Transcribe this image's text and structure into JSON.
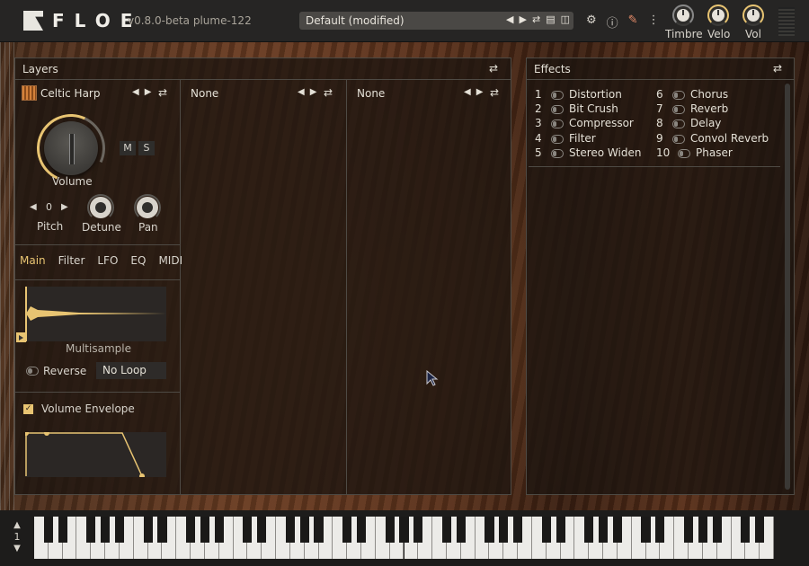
{
  "topbar": {
    "logo_text": "FLOE",
    "version": "v0.8.0-beta  plume-122",
    "preset_name": "Default (modified)",
    "preset_controls": [
      "prev-icon",
      "next-icon",
      "shuffle-icon",
      "save-icon",
      "load-icon"
    ],
    "icons": [
      "gear-icon",
      "info-icon",
      "edit-note-icon",
      "more-vertical-icon"
    ],
    "knobs": [
      {
        "label": "Timbre"
      },
      {
        "label": "Velo"
      },
      {
        "label": "Vol"
      }
    ]
  },
  "layers": {
    "title": "Layers",
    "layer1": {
      "instrument": "Celtic Harp",
      "volume_label": "Volume",
      "mute_label": "M",
      "solo_label": "S",
      "pitch_value": "0",
      "pitch_label": "Pitch",
      "detune_label": "Detune",
      "pan_label": "Pan",
      "tabs": [
        "Main",
        "Filter",
        "LFO",
        "EQ",
        "MIDI"
      ],
      "active_tab": "Main",
      "waveform_label": "Multisample",
      "reverse_label": "Reverse",
      "loop_mode": "No Loop",
      "envelope_label": "Volume Envelope",
      "envelope_enabled": true
    },
    "layer2": {
      "instrument": "None"
    },
    "layer3": {
      "instrument": "None"
    }
  },
  "effects": {
    "title": "Effects",
    "items": [
      {
        "num": "1",
        "name": "Distortion"
      },
      {
        "num": "2",
        "name": "Bit Crush"
      },
      {
        "num": "3",
        "name": "Compressor"
      },
      {
        "num": "4",
        "name": "Filter"
      },
      {
        "num": "5",
        "name": "Stereo Widen"
      },
      {
        "num": "6",
        "name": "Chorus"
      },
      {
        "num": "7",
        "name": "Reverb"
      },
      {
        "num": "8",
        "name": "Delay"
      },
      {
        "num": "9",
        "name": "Convol Reverb"
      },
      {
        "num": "10",
        "name": "Phaser"
      }
    ]
  },
  "keyboard": {
    "octave": "1"
  },
  "colors": {
    "accent": "#e8c472",
    "panel_border": "#4e4a44",
    "topbar": "#262524"
  }
}
